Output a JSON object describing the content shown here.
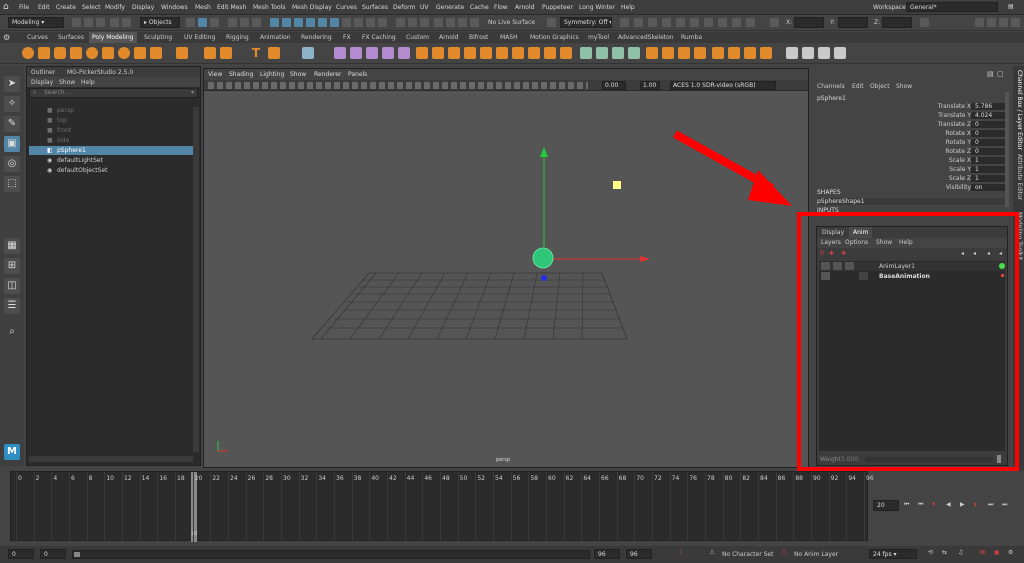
{
  "menubar": {
    "items": [
      "File",
      "Edit",
      "Create",
      "Select",
      "Modify",
      "Display",
      "Windows",
      "Mesh",
      "Edit Mesh",
      "Mesh Tools",
      "Mesh Display",
      "Curves",
      "Surfaces",
      "Deform",
      "UV",
      "Generate",
      "Cache",
      "Flow",
      "Arnold",
      "Puppeteer",
      "Long Winter",
      "Help"
    ],
    "workspace_label": "Workspace:",
    "workspace_value": "General*"
  },
  "status": {
    "mode": "Modeling",
    "objects_label": "Objects",
    "live_surface": "No Live Surface",
    "symmetry": "Symmetry: Off",
    "x": "X:",
    "y": "Y:",
    "z": "Z:"
  },
  "shelf": {
    "tabs": [
      "Curves",
      "Surfaces",
      "Poly Modeling",
      "Sculpting",
      "UV Editing",
      "Rigging",
      "Animation",
      "Rendering",
      "FX",
      "FX Caching",
      "Custom",
      "Arnold",
      "Bifrost",
      "MASH",
      "Motion Graphics",
      "myTool",
      "AdvancedSkeleton",
      "Rumba"
    ],
    "active": "Poly Modeling"
  },
  "outliner": {
    "tab1": "Outliner",
    "tab2": "MG-PickerStudio 2.5.0",
    "menu": [
      "Display",
      "Show",
      "Help"
    ],
    "search_placeholder": "Search...",
    "items": [
      {
        "label": "persp",
        "state": "dim"
      },
      {
        "label": "top",
        "state": "dim"
      },
      {
        "label": "front",
        "state": "dim"
      },
      {
        "label": "side",
        "state": "dim"
      },
      {
        "label": "pSphere1",
        "state": "selected"
      },
      {
        "label": "defaultLightSet",
        "state": "normal"
      },
      {
        "label": "defaultObjectSet",
        "state": "normal"
      }
    ]
  },
  "viewport": {
    "menu": [
      "View",
      "Shading",
      "Lighting",
      "Show",
      "Renderer",
      "Panels"
    ],
    "field1": "0.00",
    "field2": "1.00",
    "colorspace": "ACES 1.0 SDR-video (sRGB)",
    "camera_label": "persp"
  },
  "channelbox": {
    "menu": [
      "Channels",
      "Edit",
      "Object",
      "Show"
    ],
    "object": "pSphere1",
    "attrs": [
      {
        "name": "Translate X",
        "value": "5.786"
      },
      {
        "name": "Translate Y",
        "value": "4.024"
      },
      {
        "name": "Translate Z",
        "value": "0"
      },
      {
        "name": "Rotate X",
        "value": "0"
      },
      {
        "name": "Rotate Y",
        "value": "0"
      },
      {
        "name": "Rotate Z",
        "value": "0"
      },
      {
        "name": "Scale X",
        "value": "1"
      },
      {
        "name": "Scale Y",
        "value": "1"
      },
      {
        "name": "Scale Z",
        "value": "1"
      },
      {
        "name": "Visibility",
        "value": "on"
      }
    ],
    "shapes_label": "SHAPES",
    "shape_name": "pSphereShape1",
    "inputs_label": "INPUTS"
  },
  "sidetabs": [
    "Channel Box / Layer Editor",
    "Attribute Editor",
    "Modeling Toolkit"
  ],
  "layers": {
    "tabs": [
      "Display",
      "Anim"
    ],
    "menu": [
      "Layers",
      "Options",
      "Show",
      "Help"
    ],
    "rows": [
      {
        "name": "AnimLayer1"
      },
      {
        "name": "BaseAnimation"
      }
    ],
    "weight_label": "Weight",
    "weight_value": "1.000"
  },
  "timeline": {
    "ticks": [
      "0",
      "2",
      "4",
      "6",
      "8",
      "10",
      "12",
      "14",
      "16",
      "18",
      "20",
      "22",
      "24",
      "26",
      "28",
      "30",
      "32",
      "34",
      "36",
      "38",
      "40",
      "42",
      "44",
      "46",
      "48",
      "50",
      "52",
      "54",
      "56",
      "58",
      "60",
      "62",
      "64",
      "66",
      "68",
      "70",
      "72",
      "74",
      "76",
      "78",
      "80",
      "82",
      "84",
      "86",
      "88",
      "90",
      "92",
      "94",
      "96"
    ],
    "current_marker": "20",
    "current_frame": "20"
  },
  "range": {
    "start": "0",
    "start2": "0",
    "end": "96",
    "end2": "96",
    "character_set": "No Character Set",
    "anim_layer": "No Anim Layer",
    "fps": "24 fps"
  },
  "colors": {
    "accent": "#5285a6",
    "highlight": "#ff0000"
  }
}
